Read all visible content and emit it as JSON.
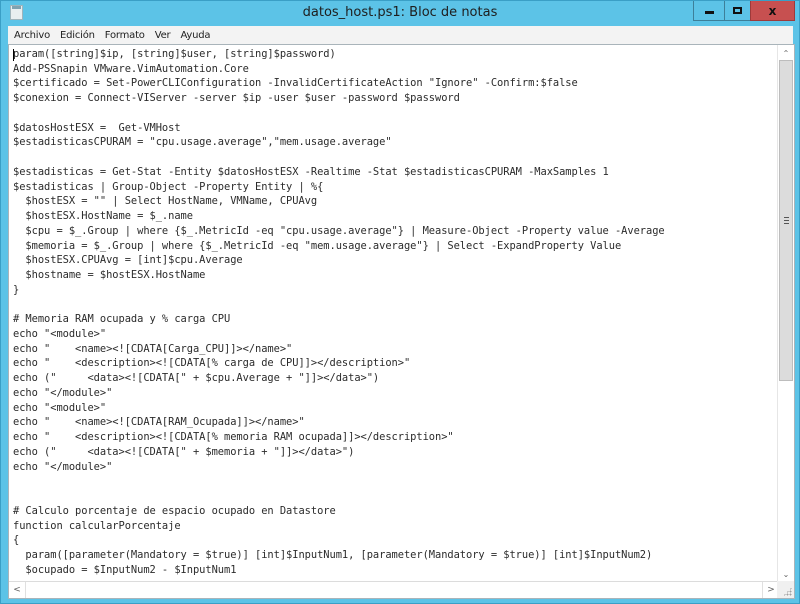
{
  "window": {
    "title": "datos_host.ps1: Bloc de notas",
    "app_icon": "notepad-icon",
    "controls": {
      "minimize": "minimize-icon",
      "maximize": "maximize-icon",
      "close_glyph": "x",
      "close_color": "#c75050"
    },
    "frame_color": "#5cc3e7"
  },
  "menu": {
    "items": [
      "Archivo",
      "Edición",
      "Formato",
      "Ver",
      "Ayuda"
    ]
  },
  "editor": {
    "lines": [
      "param([string]$ip, [string]$user, [string]$password)",
      "Add-PSSnapin VMware.VimAutomation.Core",
      "$certificado = Set-PowerCLIConfiguration -InvalidCertificateAction \"Ignore\" -Confirm:$false",
      "$conexion = Connect-VIServer -server $ip -user $user -password $password",
      "",
      "$datosHostESX =  Get-VMHost",
      "$estadisticasCPURAM = \"cpu.usage.average\",\"mem.usage.average\"",
      "",
      "$estadisticas = Get-Stat -Entity $datosHostESX -Realtime -Stat $estadisticasCPURAM -MaxSamples 1",
      "$estadisticas | Group-Object -Property Entity | %{",
      "  $hostESX = \"\" | Select HostName, VMName, CPUAvg",
      "  $hostESX.HostName = $_.name",
      "  $cpu = $_.Group | where {$_.MetricId -eq \"cpu.usage.average\"} | Measure-Object -Property value -Average",
      "  $memoria = $_.Group | where {$_.MetricId -eq \"mem.usage.average\"} | Select -ExpandProperty Value",
      "  $hostESX.CPUAvg = [int]$cpu.Average",
      "  $hostname = $hostESX.HostName",
      "}",
      "",
      "# Memoria RAM ocupada y % carga CPU",
      "echo \"<module>\"",
      "echo \"    <name><![CDATA[Carga_CPU]]></name>\"",
      "echo \"    <description><![CDATA[% carga de CPU]]></description>\"",
      "echo (\"     <data><![CDATA[\" + $cpu.Average + \"]]></data>\")",
      "echo \"</module>\"",
      "echo \"<module>\"",
      "echo \"    <name><![CDATA[RAM_Ocupada]]></name>\"",
      "echo \"    <description><![CDATA[% memoria RAM ocupada]]></description>\"",
      "echo (\"     <data><![CDATA[\" + $memoria + \"]]></data>\")",
      "echo \"</module>\"",
      "",
      "",
      "# Calculo porcentaje de espacio ocupado en Datastore",
      "function calcularPorcentaje",
      "{",
      "  param([parameter(Mandatory = $true)] [int]$InputNum1, [parameter(Mandatory = $true)] [int]$InputNum2)",
      "  $ocupado = $InputNum2 - $InputNum1"
    ]
  },
  "scrollbars": {
    "vertical": {
      "up_glyph": "^",
      "down_glyph": "v",
      "grip_icon": "grip-icon",
      "position_fraction": 0.0,
      "visible_fraction": 0.6
    },
    "horizontal": {
      "left_glyph": "<",
      "right_glyph": ">",
      "position_fraction": 0.0
    }
  }
}
